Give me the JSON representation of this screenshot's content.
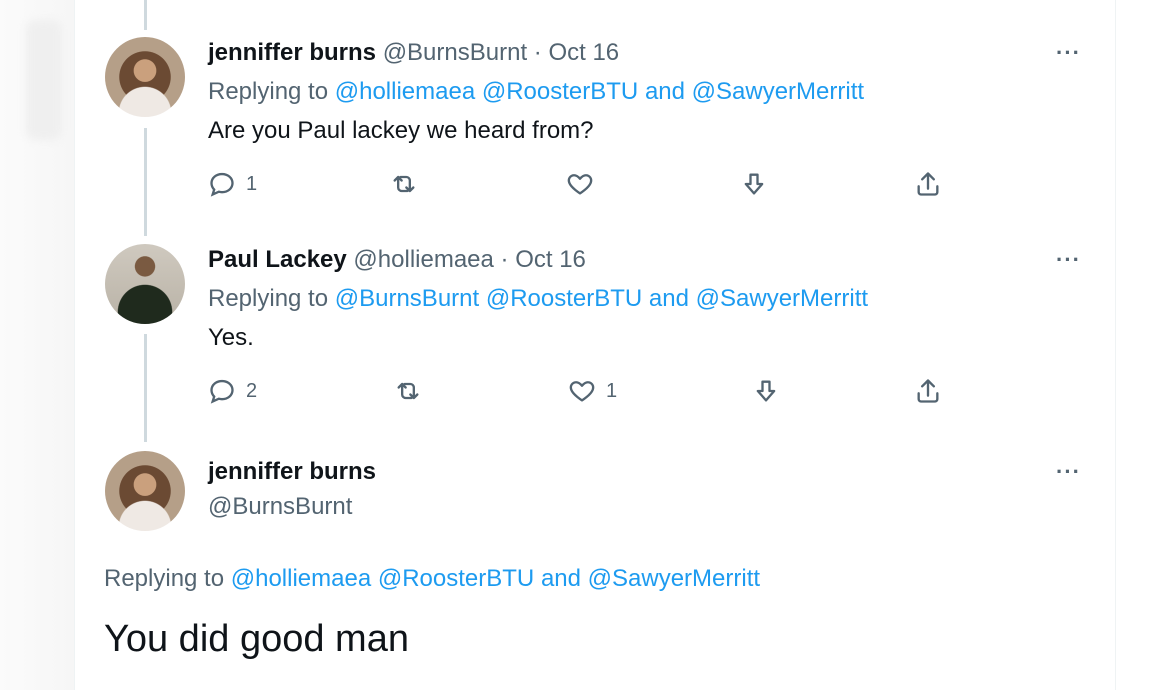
{
  "tweets": [
    {
      "name": "jenniffer burns",
      "handle": "@BurnsBurnt",
      "sep": "·",
      "date": "Oct 16",
      "replying_prefix": "Replying to",
      "mentions": [
        "@holliemaea",
        "@RoosterBTU"
      ],
      "and_word": "and",
      "last_mention": "@SawyerMerritt",
      "text": "Are you Paul lackey we heard from?",
      "reply_count": "1",
      "retweet_count": "",
      "like_count": ""
    },
    {
      "name": "Paul Lackey",
      "handle": "@holliemaea",
      "sep": "·",
      "date": "Oct 16",
      "replying_prefix": "Replying to",
      "mentions": [
        "@BurnsBurnt",
        "@RoosterBTU"
      ],
      "and_word": "and",
      "last_mention": "@SawyerMerritt",
      "text": "Yes.",
      "reply_count": "2",
      "retweet_count": "",
      "like_count": "1"
    }
  ],
  "focused": {
    "name": "jenniffer burns",
    "handle": "@BurnsBurnt",
    "replying_prefix": "Replying to",
    "mentions": [
      "@holliemaea",
      "@RoosterBTU"
    ],
    "and_word": "and",
    "last_mention": "@SawyerMerritt",
    "text": "You did good man"
  },
  "more_label": "···",
  "icons": {
    "reply": "reply-icon",
    "retweet": "retweet-icon",
    "like": "heart-icon",
    "downvote": "downvote-icon",
    "share": "share-icon"
  },
  "colors": {
    "link": "#1d9bf0",
    "secondary_text": "#536471",
    "primary_text": "#0f1419",
    "thread_line": "#cfd9de"
  }
}
